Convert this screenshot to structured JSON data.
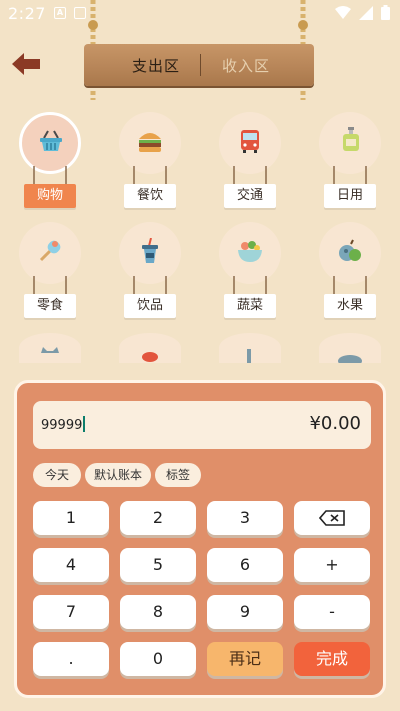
{
  "status": {
    "time": "2:27"
  },
  "header": {
    "tabs": [
      {
        "label": "支出区"
      },
      {
        "label": "收入区"
      }
    ]
  },
  "categories": [
    {
      "label": "购物",
      "icon": "shopping-basket-icon",
      "selected": true
    },
    {
      "label": "餐饮",
      "icon": "burger-icon"
    },
    {
      "label": "交通",
      "icon": "bus-icon"
    },
    {
      "label": "日用",
      "icon": "soap-bottle-icon"
    },
    {
      "label": "零食",
      "icon": "ice-cream-icon"
    },
    {
      "label": "饮品",
      "icon": "drink-cup-icon"
    },
    {
      "label": "蔬菜",
      "icon": "vegetable-bowl-icon"
    },
    {
      "label": "水果",
      "icon": "fruit-icon"
    }
  ],
  "input": {
    "note": "99999",
    "amount": "¥0.00"
  },
  "chips": [
    "今天",
    "默认账本",
    "标签"
  ],
  "keypad": {
    "rows": [
      [
        "1",
        "2",
        "3",
        "⌫"
      ],
      [
        "4",
        "5",
        "6",
        "+"
      ],
      [
        "7",
        "8",
        "9",
        "-"
      ],
      [
        ".",
        "0",
        "再记",
        "完成"
      ]
    ]
  },
  "colors": {
    "background": "#f3e3c7",
    "panel": "#e08f69",
    "accent": "#f0854d",
    "done": "#f2633c"
  }
}
